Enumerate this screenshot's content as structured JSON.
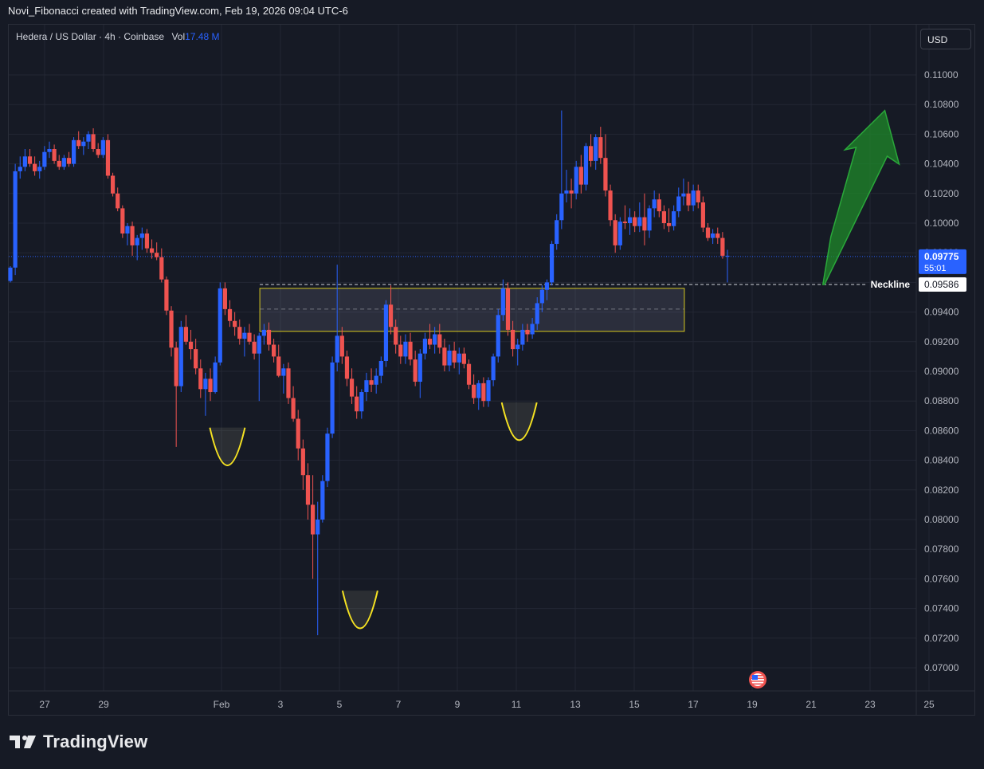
{
  "caption": "Novi_Fibonacci created with TradingView.com, Feb 19, 2026 09:04 UTC-6",
  "header": {
    "symbol_line": "Hedera / US Dollar · 4h · Coinbase",
    "vol_label": "Vol",
    "vol_value": "17.48 M",
    "currency_button": "USD"
  },
  "brand": {
    "name": "TradingView",
    "logo_icon": "tradingview-logo-icon"
  },
  "colors": {
    "background": "#161a25",
    "grid": "#232734",
    "up": "#2962ff",
    "down": "#ef5350",
    "annotation_yellow": "#f5e222",
    "arrow_green": "#1f8a2a",
    "price_label_blue": "#2962ff"
  },
  "chart_data": {
    "type": "candlestick",
    "title": "",
    "xlabel": "",
    "ylabel": "",
    "ylim": [
      0.069,
      0.1116
    ],
    "yticks": [
      "0.11000",
      "0.10800",
      "0.10600",
      "0.10400",
      "0.10200",
      "0.10000",
      "0.09800",
      "0.09600",
      "0.09400",
      "0.09200",
      "0.09000",
      "0.08800",
      "0.08600",
      "0.08400",
      "0.08200",
      "0.08000",
      "0.07800",
      "0.07600",
      "0.07400",
      "0.07200",
      "0.07000"
    ],
    "xticks": [
      {
        "label": "27",
        "day": -5
      },
      {
        "label": "29",
        "day": -3
      },
      {
        "label": "Feb",
        "day": 1
      },
      {
        "label": "3",
        "day": 3
      },
      {
        "label": "5",
        "day": 5
      },
      {
        "label": "7",
        "day": 7
      },
      {
        "label": "9",
        "day": 9
      },
      {
        "label": "11",
        "day": 11
      },
      {
        "label": "13",
        "day": 13
      },
      {
        "label": "15",
        "day": 15
      },
      {
        "label": "17",
        "day": 17
      },
      {
        "label": "19",
        "day": 19
      },
      {
        "label": "21",
        "day": 21
      },
      {
        "label": "23",
        "day": 23
      },
      {
        "label": "25",
        "day": 25
      }
    ],
    "grid": true,
    "candle_interval": "4h",
    "candles_start": "Jan 26, 2026",
    "candles": [
      [
        0.0961,
        0.0971,
        0.096,
        0.097
      ],
      [
        0.097,
        0.104,
        0.0965,
        0.1035
      ],
      [
        0.1035,
        0.1045,
        0.103,
        0.1038
      ],
      [
        0.1038,
        0.105,
        0.1035,
        0.1045
      ],
      [
        0.1045,
        0.105,
        0.1038,
        0.104
      ],
      [
        0.104,
        0.1045,
        0.1032,
        0.1035
      ],
      [
        0.1035,
        0.1042,
        0.103,
        0.1038
      ],
      [
        0.1038,
        0.1052,
        0.1036,
        0.1048
      ],
      [
        0.1048,
        0.1055,
        0.1044,
        0.105
      ],
      [
        0.105,
        0.1053,
        0.104,
        0.1042
      ],
      [
        0.1042,
        0.1046,
        0.1036,
        0.1038
      ],
      [
        0.1038,
        0.1046,
        0.1036,
        0.1044
      ],
      [
        0.1044,
        0.1048,
        0.1038,
        0.104
      ],
      [
        0.104,
        0.1058,
        0.1038,
        0.1056
      ],
      [
        0.1056,
        0.1062,
        0.105,
        0.1052
      ],
      [
        0.1052,
        0.1058,
        0.1046,
        0.1055
      ],
      [
        0.1055,
        0.1062,
        0.105,
        0.106
      ],
      [
        0.106,
        0.1064,
        0.1048,
        0.105
      ],
      [
        0.105,
        0.1054,
        0.1044,
        0.1046
      ],
      [
        0.1046,
        0.1058,
        0.1044,
        0.1056
      ],
      [
        0.1056,
        0.106,
        0.103,
        0.1032
      ],
      [
        0.1032,
        0.1034,
        0.1018,
        0.102
      ],
      [
        0.102,
        0.1024,
        0.1008,
        0.101
      ],
      [
        0.101,
        0.1012,
        0.099,
        0.0993
      ],
      [
        0.0993,
        0.1,
        0.0985,
        0.0998
      ],
      [
        0.0998,
        0.1001,
        0.0978,
        0.0985
      ],
      [
        0.0985,
        0.0992,
        0.0975,
        0.099
      ],
      [
        0.099,
        0.0997,
        0.0982,
        0.0993
      ],
      [
        0.0993,
        0.0996,
        0.098,
        0.0983
      ],
      [
        0.0983,
        0.0989,
        0.0976,
        0.098
      ],
      [
        0.098,
        0.0987,
        0.0975,
        0.0977
      ],
      [
        0.0977,
        0.0983,
        0.096,
        0.0962
      ],
      [
        0.0962,
        0.0964,
        0.0938,
        0.0941
      ],
      [
        0.0941,
        0.0944,
        0.091,
        0.0916
      ],
      [
        0.0916,
        0.092,
        0.0849,
        0.089
      ],
      [
        0.089,
        0.0934,
        0.0886,
        0.093
      ],
      [
        0.093,
        0.0938,
        0.0918,
        0.092
      ],
      [
        0.092,
        0.0928,
        0.0908,
        0.0915
      ],
      [
        0.0915,
        0.0922,
        0.0898,
        0.0902
      ],
      [
        0.0902,
        0.0908,
        0.0882,
        0.0888
      ],
      [
        0.0888,
        0.0899,
        0.087,
        0.0895
      ],
      [
        0.0895,
        0.0902,
        0.088,
        0.0886
      ],
      [
        0.0886,
        0.091,
        0.0885,
        0.0906
      ],
      [
        0.0906,
        0.096,
        0.0904,
        0.0956
      ],
      [
        0.0956,
        0.096,
        0.0938,
        0.0942
      ],
      [
        0.0942,
        0.0948,
        0.093,
        0.0934
      ],
      [
        0.0934,
        0.094,
        0.0924,
        0.093
      ],
      [
        0.093,
        0.0935,
        0.0918,
        0.0922
      ],
      [
        0.0922,
        0.093,
        0.091,
        0.0926
      ],
      [
        0.0926,
        0.0932,
        0.0918,
        0.092
      ],
      [
        0.092,
        0.0925,
        0.0908,
        0.0912
      ],
      [
        0.0912,
        0.0926,
        0.088,
        0.0924
      ],
      [
        0.0924,
        0.0932,
        0.0918,
        0.0928
      ],
      [
        0.0928,
        0.0933,
        0.0914,
        0.0918
      ],
      [
        0.0918,
        0.0922,
        0.0906,
        0.091
      ],
      [
        0.091,
        0.0918,
        0.0896,
        0.0897
      ],
      [
        0.0897,
        0.0905,
        0.0885,
        0.0902
      ],
      [
        0.0902,
        0.0906,
        0.0878,
        0.0882
      ],
      [
        0.0882,
        0.089,
        0.0866,
        0.0868
      ],
      [
        0.0868,
        0.0874,
        0.084,
        0.0848
      ],
      [
        0.0848,
        0.0854,
        0.082,
        0.083
      ],
      [
        0.083,
        0.0838,
        0.08,
        0.081
      ],
      [
        0.081,
        0.083,
        0.076,
        0.079
      ],
      [
        0.079,
        0.0812,
        0.0722,
        0.08
      ],
      [
        0.08,
        0.083,
        0.0798,
        0.0826
      ],
      [
        0.0826,
        0.0862,
        0.0822,
        0.0858
      ],
      [
        0.0858,
        0.091,
        0.0855,
        0.0906
      ],
      [
        0.0906,
        0.0972,
        0.09,
        0.0924
      ],
      [
        0.0924,
        0.093,
        0.0905,
        0.091
      ],
      [
        0.091,
        0.0914,
        0.089,
        0.0895
      ],
      [
        0.0895,
        0.0902,
        0.0878,
        0.0883
      ],
      [
        0.0883,
        0.089,
        0.0868,
        0.0873
      ],
      [
        0.0873,
        0.0888,
        0.0868,
        0.0886
      ],
      [
        0.0886,
        0.0899,
        0.088,
        0.0894
      ],
      [
        0.0894,
        0.0902,
        0.0886,
        0.0891
      ],
      [
        0.0891,
        0.0902,
        0.0885,
        0.0897
      ],
      [
        0.0897,
        0.091,
        0.0892,
        0.0907
      ],
      [
        0.0907,
        0.0948,
        0.0903,
        0.0945
      ],
      [
        0.0945,
        0.0958,
        0.0925,
        0.093
      ],
      [
        0.093,
        0.0935,
        0.0912,
        0.0918
      ],
      [
        0.0918,
        0.0924,
        0.0905,
        0.091
      ],
      [
        0.091,
        0.0925,
        0.0905,
        0.092
      ],
      [
        0.092,
        0.0926,
        0.0904,
        0.0908
      ],
      [
        0.0908,
        0.0914,
        0.089,
        0.0893
      ],
      [
        0.0893,
        0.0915,
        0.0882,
        0.0912
      ],
      [
        0.0912,
        0.0926,
        0.0908,
        0.0922
      ],
      [
        0.0922,
        0.0932,
        0.0915,
        0.0918
      ],
      [
        0.0918,
        0.093,
        0.0912,
        0.0925
      ],
      [
        0.0925,
        0.0932,
        0.0912,
        0.0916
      ],
      [
        0.0916,
        0.0922,
        0.09,
        0.0904
      ],
      [
        0.0904,
        0.0918,
        0.09,
        0.0914
      ],
      [
        0.0914,
        0.092,
        0.0902,
        0.0906
      ],
      [
        0.0906,
        0.0916,
        0.0898,
        0.0912
      ],
      [
        0.0912,
        0.0916,
        0.0902,
        0.0905
      ],
      [
        0.0905,
        0.0908,
        0.0888,
        0.0891
      ],
      [
        0.0891,
        0.0898,
        0.0878,
        0.0882
      ],
      [
        0.0882,
        0.0894,
        0.0874,
        0.0892
      ],
      [
        0.0892,
        0.0896,
        0.0876,
        0.088
      ],
      [
        0.088,
        0.0896,
        0.0876,
        0.0894
      ],
      [
        0.0894,
        0.0912,
        0.089,
        0.091
      ],
      [
        0.091,
        0.0942,
        0.0906,
        0.0938
      ],
      [
        0.0938,
        0.0962,
        0.0934,
        0.0956
      ],
      [
        0.0956,
        0.096,
        0.0924,
        0.0928
      ],
      [
        0.0928,
        0.0934,
        0.091,
        0.0915
      ],
      [
        0.0915,
        0.0922,
        0.0904,
        0.0918
      ],
      [
        0.0918,
        0.0932,
        0.0914,
        0.0928
      ],
      [
        0.0928,
        0.0932,
        0.092,
        0.0925
      ],
      [
        0.0925,
        0.0936,
        0.0922,
        0.0932
      ],
      [
        0.0932,
        0.095,
        0.0928,
        0.0946
      ],
      [
        0.0946,
        0.0958,
        0.094,
        0.0955
      ],
      [
        0.0955,
        0.0962,
        0.0948,
        0.096
      ],
      [
        0.096,
        0.0988,
        0.0958,
        0.0986
      ],
      [
        0.0986,
        0.1006,
        0.0982,
        0.1002
      ],
      [
        0.1002,
        0.1076,
        0.0996,
        0.102
      ],
      [
        0.102,
        0.1036,
        0.1014,
        0.1022
      ],
      [
        0.1022,
        0.103,
        0.101,
        0.102
      ],
      [
        0.102,
        0.1042,
        0.1016,
        0.1038
      ],
      [
        0.1038,
        0.1046,
        0.102,
        0.1026
      ],
      [
        0.1026,
        0.1054,
        0.1022,
        0.1052
      ],
      [
        0.1052,
        0.106,
        0.1038,
        0.1042
      ],
      [
        0.1042,
        0.106,
        0.1036,
        0.1058
      ],
      [
        0.1058,
        0.1065,
        0.104,
        0.1044
      ],
      [
        0.1044,
        0.106,
        0.1018,
        0.1022
      ],
      [
        0.1022,
        0.1026,
        0.0998,
        0.1002
      ],
      [
        0.1002,
        0.1006,
        0.098,
        0.0985
      ],
      [
        0.0985,
        0.1004,
        0.0982,
        0.1001
      ],
      [
        0.1001,
        0.1012,
        0.0996,
        0.1
      ],
      [
        0.1,
        0.101,
        0.0992,
        0.1004
      ],
      [
        0.1004,
        0.1008,
        0.0994,
        0.0998
      ],
      [
        0.0998,
        0.1014,
        0.0994,
        0.1004
      ],
      [
        0.1004,
        0.102,
        0.0985,
        0.0995
      ],
      [
        0.0995,
        0.1012,
        0.099,
        0.101
      ],
      [
        0.101,
        0.1022,
        0.1004,
        0.1016
      ],
      [
        0.1016,
        0.102,
        0.1004,
        0.1008
      ],
      [
        0.1008,
        0.1012,
        0.0996,
        0.1
      ],
      [
        0.1,
        0.101,
        0.0994,
        0.0998
      ],
      [
        0.0998,
        0.1012,
        0.0995,
        0.1008
      ],
      [
        0.1008,
        0.1024,
        0.1004,
        0.1018
      ],
      [
        0.1018,
        0.103,
        0.1012,
        0.102
      ],
      [
        0.102,
        0.1028,
        0.1008,
        0.1012
      ],
      [
        0.1012,
        0.1026,
        0.1008,
        0.1022
      ],
      [
        0.1022,
        0.1026,
        0.101,
        0.1014
      ],
      [
        0.1014,
        0.1018,
        0.0994,
        0.0997
      ],
      [
        0.0997,
        0.1,
        0.0988,
        0.099
      ],
      [
        0.099,
        0.0996,
        0.0986,
        0.0993
      ],
      [
        0.0993,
        0.0997,
        0.0986,
        0.099
      ],
      [
        0.099,
        0.0994,
        0.0976,
        0.0978
      ],
      [
        0.0978,
        0.0982,
        0.096,
        0.0978
      ]
    ],
    "last_price": "0.09775",
    "countdown": "55:01",
    "neckline": {
      "label": "Neckline",
      "value": 0.09586,
      "value_label": "0.09586"
    },
    "zone": {
      "top": 0.0956,
      "bottom": 0.0927,
      "mid": 0.0942,
      "from_day": 2.3,
      "to_day": 16.7
    },
    "annotations": [
      {
        "shape": "curve",
        "name": "left-shoulder-curve",
        "day": 1.2,
        "low": 0.0823,
        "high": 0.0862
      },
      {
        "shape": "curve",
        "name": "head-curve",
        "day": 5.7,
        "low": 0.0713,
        "high": 0.0752
      },
      {
        "shape": "curve",
        "name": "right-shoulder-curve",
        "day": 11.1,
        "low": 0.084,
        "high": 0.0879
      }
    ],
    "target_arrow": {
      "from_day": 21.4,
      "from_value": 0.09586,
      "to_day": 23.5,
      "to_value": 0.1076
    }
  }
}
